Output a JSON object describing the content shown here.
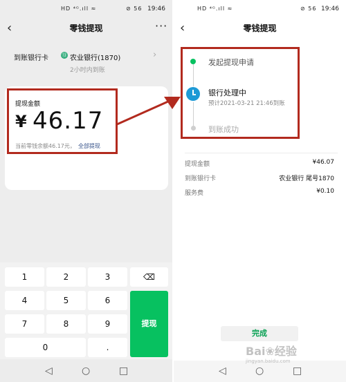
{
  "left": {
    "status": {
      "signal": "HD ⁴ᴳ.ıll ≈",
      "icons": "⊘ 56",
      "time": "19:46"
    },
    "header": {
      "back": "‹",
      "title": "零钱提现",
      "more": "···"
    },
    "bank": {
      "label": "到账银行卡",
      "icon": "⑬",
      "name": "农业银行(1870)",
      "eta": "2小时内到账",
      "chevron": "›"
    },
    "card": {
      "label": "提现金额",
      "currency": "¥",
      "amount": "46.17",
      "balance_text": "当前零钱余额46.17元，",
      "withdraw_all": "全部提现"
    },
    "keypad": {
      "keys": [
        "1",
        "2",
        "3",
        "4",
        "5",
        "6",
        "7",
        "8",
        "9",
        "0",
        "."
      ],
      "delete": "⌫",
      "submit": "提现"
    },
    "nav": {
      "back": "◁",
      "home": "○",
      "recent": "□"
    }
  },
  "right": {
    "status": {
      "signal": "HD ⁴ᴳ.ıll ≈",
      "icons": "⊘ 56",
      "time": "19:46"
    },
    "header": {
      "back": "‹",
      "title": "零钱提现"
    },
    "timeline": [
      {
        "title": "发起提现申请",
        "sub": ""
      },
      {
        "title": "银行处理中",
        "sub": "预计2021-03-21 21:46到账"
      },
      {
        "title": "到账成功",
        "sub": ""
      }
    ],
    "details": [
      {
        "label": "提现金额",
        "value": "¥46.07"
      },
      {
        "label": "到账银行卡",
        "value": "农业银行 尾号1870"
      },
      {
        "label": "服务费",
        "value": "¥0.10"
      }
    ],
    "done": "完成",
    "nav": {
      "back": "◁",
      "home": "○",
      "recent": "□"
    }
  },
  "watermark": {
    "main": "Bai❀经验",
    "sub": "jingyan.baidu.com"
  },
  "colors": {
    "highlight": "#b22a1e",
    "wechat_green": "#07c160",
    "processing_blue": "#1e9ad6"
  }
}
